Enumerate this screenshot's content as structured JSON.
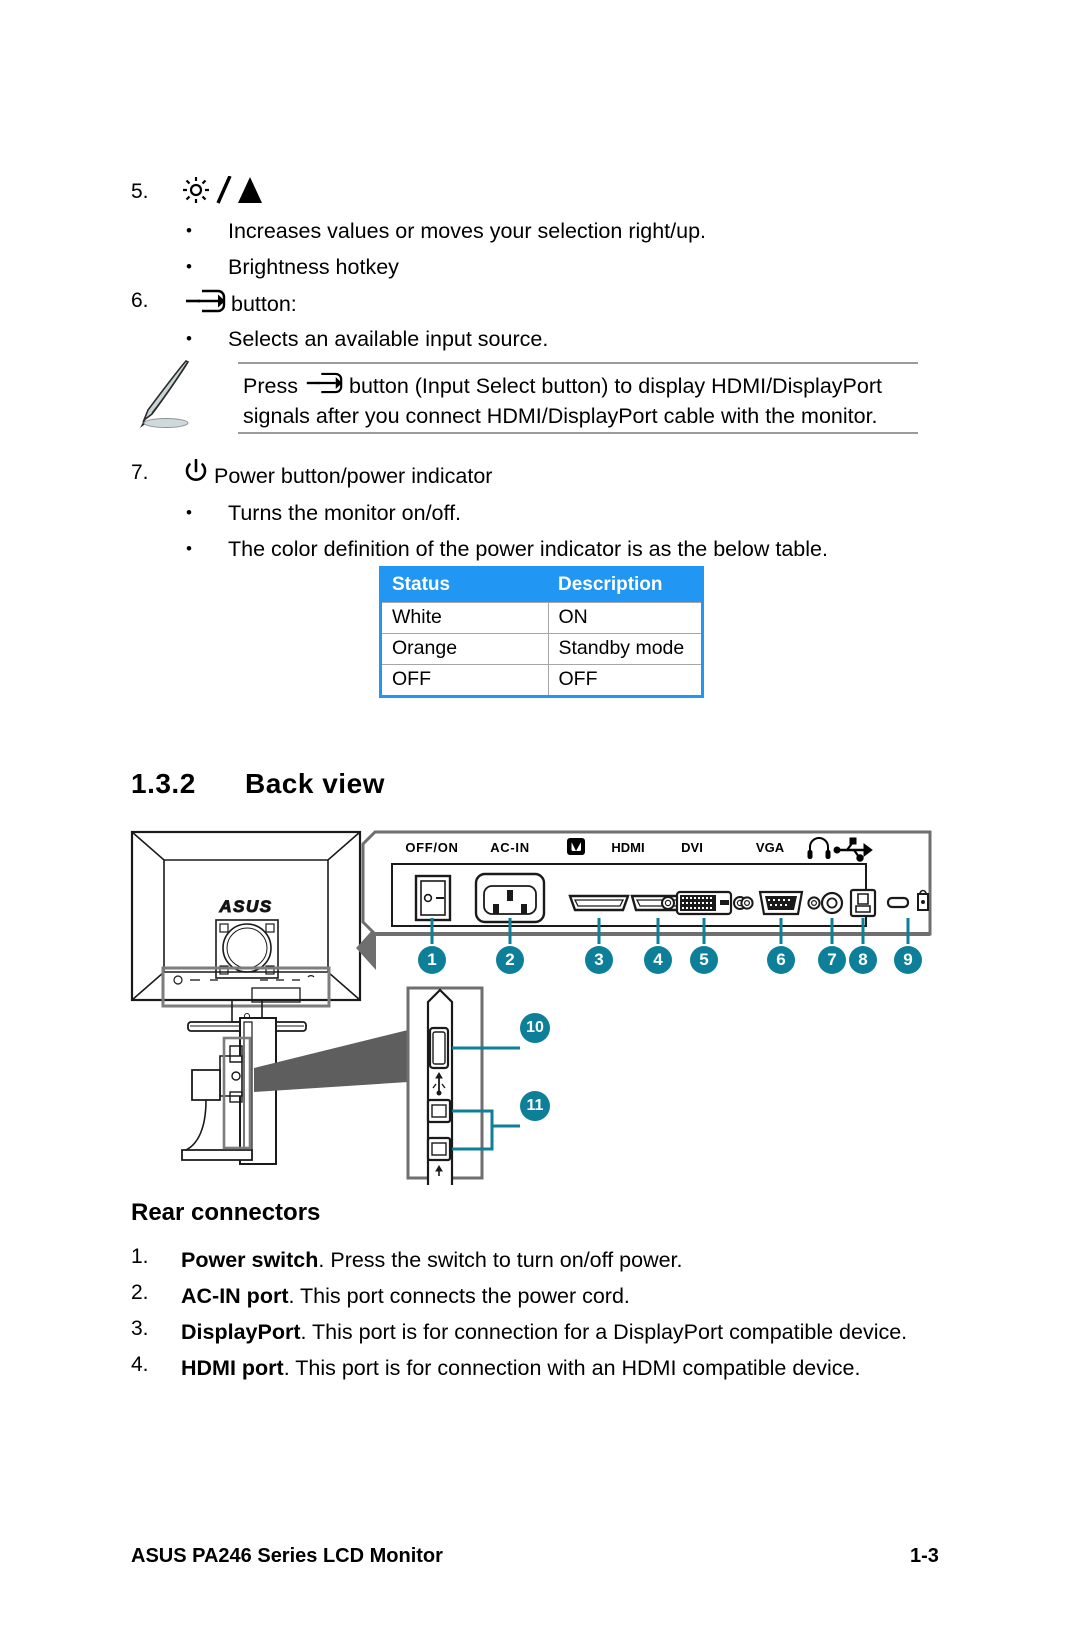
{
  "items": {
    "item5": {
      "number": "5.",
      "icon": "brightness-up-icon",
      "bullets": [
        "Increases values or moves your selection right/up.",
        "Brightness hotkey"
      ]
    },
    "item6": {
      "number": "6.",
      "icon": "input-select-icon",
      "label": "button:",
      "bullets": [
        "Selects an available input source."
      ]
    },
    "note": {
      "icon": "pencil-note-icon",
      "line1_before": "Press",
      "line1_icon": "input-select-icon",
      "line1_after": "button (Input Select button) to display HDMI/DisplayPort",
      "line2": "signals after you connect HDMI/DisplayPort cable with the monitor."
    },
    "item7": {
      "number": "7.",
      "icon": "power-icon",
      "label": "Power button/power indicator",
      "bullets": [
        "Turns the monitor on/off.",
        "The color definition of the power indicator is as the below table."
      ]
    }
  },
  "status_table": {
    "headers": [
      "Status",
      "Description"
    ],
    "rows": [
      [
        "White",
        "ON"
      ],
      [
        "Orange",
        "Standby mode"
      ],
      [
        "OFF",
        "OFF"
      ]
    ],
    "header_bg": "#2196f3",
    "header_fg": "#ffffff"
  },
  "section": {
    "number": "1.3.2",
    "title": "Back view",
    "subtitle": "Rear connectors"
  },
  "figure": {
    "brand": "ASUS",
    "port_labels": [
      "OFF/ON",
      "AC-IN",
      "DisplayPort",
      "HDMI",
      "DVI",
      "VGA",
      "headphone",
      "USB"
    ],
    "port_label_texts": {
      "power": "OFF/ON",
      "acin": "AC-IN",
      "dp": "DP",
      "hdmi": "HDMI",
      "dvi": "DVI",
      "vga": "VGA"
    },
    "callouts": [
      "1",
      "2",
      "3",
      "4",
      "5",
      "6",
      "7",
      "8",
      "9",
      "10",
      "11"
    ],
    "callout_color": "#0d7f99"
  },
  "rear_connectors": [
    {
      "number": "1.",
      "bold": "Power switch",
      "text": ". Press the switch to turn on/off power."
    },
    {
      "number": "2.",
      "bold": "AC-IN port",
      "text": ". This port connects the power cord."
    },
    {
      "number": "3.",
      "bold": "DisplayPort",
      "text": ". This port is for connection for a DisplayPort compatible device."
    },
    {
      "number": "4.",
      "bold": "HDMI port",
      "text": ". This port is for connection with an HDMI compatible device."
    }
  ],
  "footer": {
    "left": "ASUS PA246 Series LCD Monitor",
    "right": "1-3"
  }
}
